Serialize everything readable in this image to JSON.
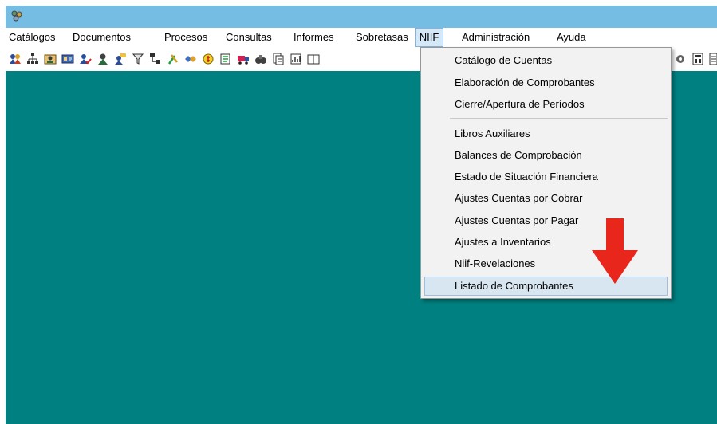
{
  "menubar": {
    "items": [
      {
        "label": "Catálogos"
      },
      {
        "label": "Documentos"
      },
      {
        "label": "Procesos"
      },
      {
        "label": "Consultas"
      },
      {
        "label": "Informes"
      },
      {
        "label": "Sobretasas"
      },
      {
        "label": "NIIF",
        "active": true
      },
      {
        "label": "Administración"
      },
      {
        "label": "Ayuda"
      }
    ]
  },
  "niif_menu": {
    "group1": [
      "Catálogo de Cuentas",
      "Elaboración de Comprobantes",
      "Cierre/Apertura de Períodos"
    ],
    "group2": [
      "Libros Auxiliares",
      "Balances de Comprobación",
      "Estado de Situación Financiera",
      "Ajustes Cuentas por Cobrar",
      "Ajustes Cuentas por Pagar",
      "Ajustes a Inventarios",
      "Niif-Revelaciones",
      "Listado de Comprobantes"
    ],
    "highlighted": "Listado de Comprobantes"
  },
  "colors": {
    "titlebar": "#76bde3",
    "workspace": "#008080",
    "annotation_arrow": "#e8261b"
  },
  "toolbar": {
    "icons": [
      "people-icon",
      "org-chart-icon",
      "user-card-icon",
      "id-card-icon",
      "user-check-icon",
      "person-icon",
      "user-chat-icon",
      "filter-icon",
      "hierarchy-icon",
      "tools-icon",
      "handshake-icon",
      "money-icon",
      "report-icon",
      "truck-icon",
      "binoculars-icon",
      "document-icon",
      "chart-doc-icon",
      "book-icon",
      "settings-icon",
      "calculator-icon",
      "notes-icon"
    ]
  }
}
